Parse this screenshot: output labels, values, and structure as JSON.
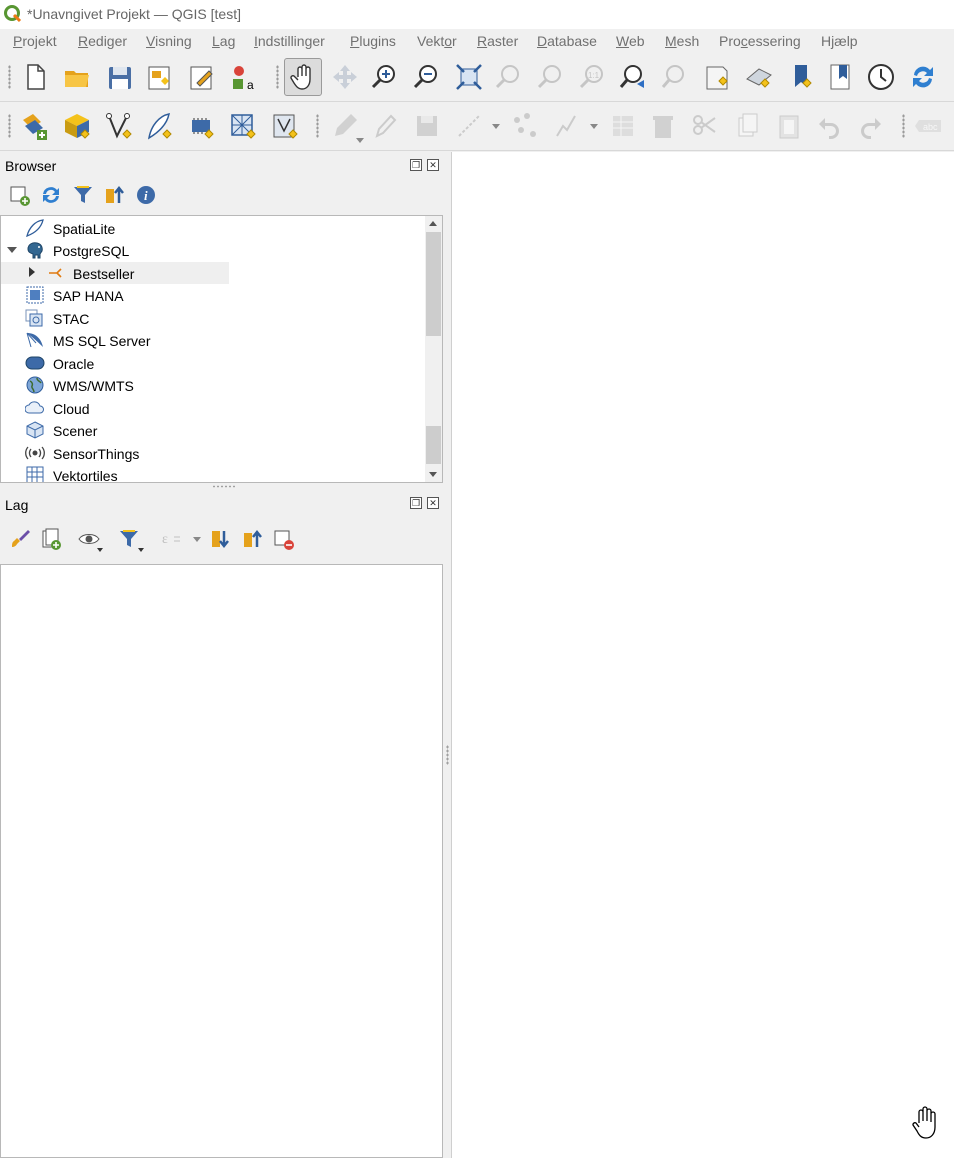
{
  "window": {
    "title": "*Unavngivet Projekt — QGIS [test]"
  },
  "menu": [
    {
      "label": "Projekt",
      "ul": "P"
    },
    {
      "label": "Rediger",
      "ul": "R"
    },
    {
      "label": "Visning",
      "ul": "V"
    },
    {
      "label": "Lag",
      "ul": "L"
    },
    {
      "label": "Indstillinger",
      "ul": "I"
    },
    {
      "label": "Plugins",
      "ul": "P"
    },
    {
      "label": "Vektor",
      "ul": "o"
    },
    {
      "label": "Raster",
      "ul": "R"
    },
    {
      "label": "Database",
      "ul": "D"
    },
    {
      "label": "Web",
      "ul": "W"
    },
    {
      "label": "Mesh",
      "ul": "M"
    },
    {
      "label": "Processering",
      "ul": "c"
    },
    {
      "label": "Hjælp",
      "ul": "j"
    }
  ],
  "browser": {
    "title": "Browser",
    "items": [
      {
        "label": "SpatiaLite",
        "icon": "feather-icon"
      },
      {
        "label": "PostgreSQL",
        "icon": "elephant-icon",
        "expanded": true
      },
      {
        "label": "Bestseller",
        "icon": "connection-icon",
        "child": true,
        "selected": true
      },
      {
        "label": "SAP HANA",
        "icon": "sap-hana-icon"
      },
      {
        "label": "STAC",
        "icon": "stac-icon"
      },
      {
        "label": "MS SQL Server",
        "icon": "mssql-icon"
      },
      {
        "label": "Oracle",
        "icon": "oracle-icon"
      },
      {
        "label": "WMS/WMTS",
        "icon": "globe-icon"
      },
      {
        "label": "Cloud",
        "icon": "cloud-icon"
      },
      {
        "label": "Scener",
        "icon": "cube-icon"
      },
      {
        "label": "SensorThings",
        "icon": "sensor-icon"
      },
      {
        "label": "Vektortiles",
        "icon": "grid-icon"
      }
    ]
  },
  "layers": {
    "title": "Lag"
  },
  "colors": {
    "accent": "#3e78c1",
    "toolbar_bg": "#f0f0f0",
    "qgis_green": "#589632",
    "star": "#f4c21b"
  }
}
